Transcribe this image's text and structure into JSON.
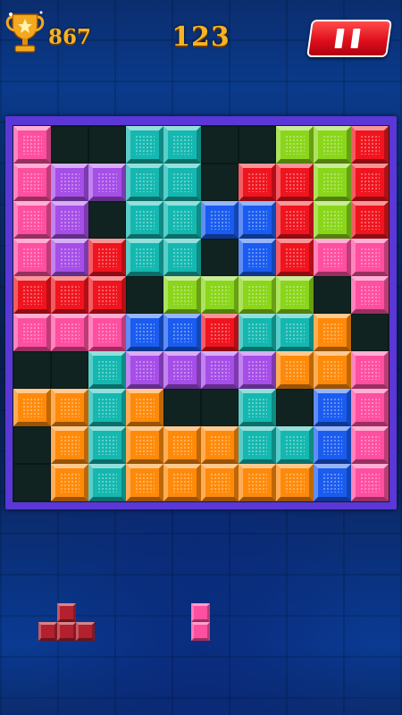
{
  "hud": {
    "best_score": "867",
    "current_score": "123"
  },
  "icons": {
    "trophy": "trophy-icon",
    "pause": "pause-icon"
  },
  "colors": {
    "pink": "#ff4fa0",
    "purple": "#a64ee8",
    "teal": "#14b8b0",
    "lime": "#8ad61a",
    "red": "#f0141e",
    "blue": "#1a5cf0",
    "orange": "#ff8a0a",
    "frame": "#5a37d6",
    "empty": "#102320"
  },
  "board": {
    "size": 10,
    "rows": [
      [
        "pink",
        null,
        null,
        "teal",
        "teal",
        null,
        null,
        "lime",
        "lime",
        "red"
      ],
      [
        "pink",
        "purple",
        "purple",
        "teal",
        "teal",
        null,
        "red",
        "red",
        "lime",
        "red"
      ],
      [
        "pink",
        "purple",
        null,
        "teal",
        "teal",
        "blue",
        "blue",
        "red",
        "lime",
        "red"
      ],
      [
        "pink",
        "purple",
        "red",
        "teal",
        "teal",
        null,
        "blue",
        "red",
        "pink",
        "pink"
      ],
      [
        "red",
        "red",
        "red",
        null,
        "lime",
        "lime",
        "lime",
        "lime",
        null,
        "pink"
      ],
      [
        "pink",
        "pink",
        "pink",
        "blue",
        "blue",
        "red",
        "teal",
        "teal",
        "orange",
        null
      ],
      [
        null,
        null,
        "teal",
        "purple",
        "purple",
        "purple",
        "purple",
        "orange",
        "orange",
        "pink"
      ],
      [
        "orange",
        "orange",
        "teal",
        "orange",
        null,
        null,
        "teal",
        null,
        "blue",
        "pink"
      ],
      [
        null,
        "orange",
        "teal",
        "orange",
        "orange",
        "orange",
        "teal",
        "teal",
        "blue",
        "pink"
      ],
      [
        null,
        "orange",
        "teal",
        "orange",
        "orange",
        "orange",
        "orange",
        "orange",
        "blue",
        "pink"
      ]
    ]
  },
  "tray": {
    "pieces": [
      {
        "name": "t-piece",
        "color": "#b3202e",
        "cells": [
          [
            0,
            1
          ],
          [
            1,
            0
          ],
          [
            1,
            1
          ],
          [
            1,
            2
          ]
        ]
      },
      {
        "name": "vertical-two-piece",
        "color": "#ff4fa0",
        "cells": [
          [
            0,
            0
          ],
          [
            1,
            0
          ]
        ]
      }
    ]
  }
}
